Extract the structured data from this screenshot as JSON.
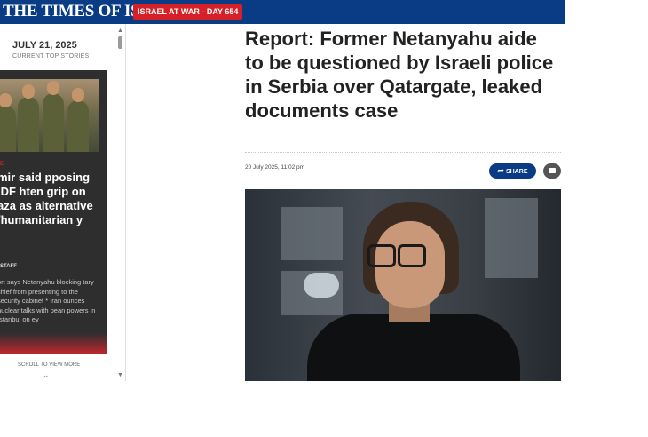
{
  "header": {
    "brand": "THE TIMES OF ISRAEL",
    "badge": "ISRAEL AT WAR - DAY 654",
    "brand_color": "#0a3c86",
    "badge_color": "#d62027"
  },
  "sidebar": {
    "date": "JULY 21, 2025",
    "subtitle": "CURRENT TOP STORIES",
    "card": {
      "tag": "E",
      "headline": "mir said pposing IDF hten grip on aza as alternative /humanitarian y",
      "byline": "STAFF",
      "summary": "ort says Netanyahu blocking tary chief from presenting to the security cabinet * Iran ounces nuclear talks with pean powers in Istanbul on ey"
    },
    "scroll_hint": "SCROLL TO VIEW MORE"
  },
  "article": {
    "headline": "Report: Former Netanyahu aide to be questioned by Israeli police in Serbia over Qatargate, leaked documents case",
    "date": "20 July 2025, 11:02 pm",
    "share_label": "SHARE"
  },
  "icons": {
    "share": "share-arrow-icon",
    "comment": "comment-bubble-icon",
    "scroll_down": "chevron-down-icon"
  }
}
